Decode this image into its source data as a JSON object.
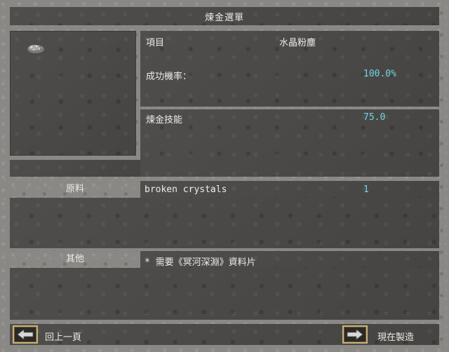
{
  "window": {
    "title": "煉金選單"
  },
  "item": {
    "icon": "crystal-powder-icon"
  },
  "details": {
    "item_label": "項目",
    "item_value": "水晶粉塵",
    "success_label": "成功機率：",
    "success_value": "100.0%",
    "skill_label": "煉金技能",
    "skill_value": "75.0"
  },
  "materials": {
    "label": "原料",
    "rows": [
      {
        "name": "broken crystals",
        "qty": "1"
      }
    ]
  },
  "other": {
    "label": "其他",
    "rows": [
      "* 需要《冥河深淵》資料片"
    ]
  },
  "footer": {
    "back_label": "回上一頁",
    "make_label": "現在製造",
    "back_icon": "left-arrow-icon",
    "make_icon": "right-arrow-icon"
  },
  "colors": {
    "accent_value": "#6fd6e0",
    "button_border": "#c9b27a"
  }
}
